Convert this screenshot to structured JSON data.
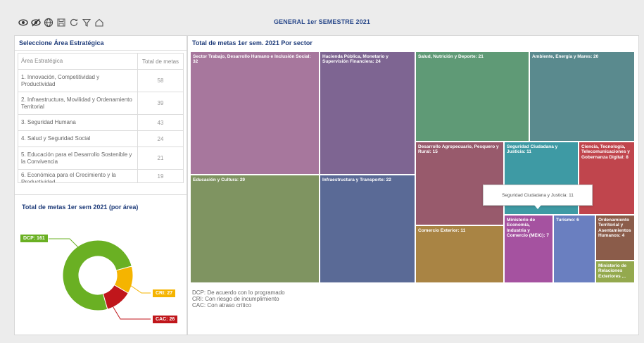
{
  "page_title": "GENERAL 1er SEMESTRE 2021",
  "toolbar": {
    "icons": [
      "visibility-icon",
      "visibility-off-icon",
      "globe-icon",
      "save-icon",
      "refresh-icon",
      "filter-icon",
      "home-icon"
    ]
  },
  "area_table": {
    "title": "Seleccione Área Estratégica",
    "col_area": "Área Estratégica",
    "col_total": "Total de metas",
    "rows": [
      {
        "area": "1. Innovación, Competitividad y Productividad",
        "total": "58"
      },
      {
        "area": "2. Infraestructura, Movilidad y Ordenamiento Territorial",
        "total": "39"
      },
      {
        "area": "3. Seguridad Humana",
        "total": "43"
      },
      {
        "area": "4. Salud y Seguridad Social",
        "total": "24"
      },
      {
        "area": "5. Educación para el Desarrollo Sostenible y la Convivencia",
        "total": "21"
      },
      {
        "area": "6. Económica para el Crecimiento y la Productividad",
        "total": "19"
      }
    ]
  },
  "donut": {
    "title": "Total de metas 1er sem 2021 (por área)",
    "labels": {
      "dcp": "DCP: 161",
      "cri": "CRI: 27",
      "cac": "CAC: 26"
    },
    "colors": {
      "dcp": "#6ab023",
      "cri": "#f5b400",
      "cac": "#c0161b"
    },
    "chart_data": {
      "type": "pie",
      "categories": [
        "DCP",
        "CRI",
        "CAC"
      ],
      "values": [
        161,
        27,
        26
      ]
    }
  },
  "treemap": {
    "title": "Total de metas 1er sem. 2021 Por sector",
    "cells": [
      {
        "label": "Sector Trabajo, Desarrollo Humano e Inclusión Social: 32",
        "value": 32,
        "color": "#a7779d"
      },
      {
        "label": "Hacienda Pública, Monetario y Supervisión Financiera: 24",
        "value": 24,
        "color": "#7e6592"
      },
      {
        "label": "Salud, Nutrición y Deporte: 21",
        "value": 21,
        "color": "#5f9a76"
      },
      {
        "label": "Ambiente, Energía y Mares: 20",
        "value": 20,
        "color": "#5a8a8e"
      },
      {
        "label": "Educación y Cultura: 29",
        "value": 29,
        "color": "#7f9461"
      },
      {
        "label": "Infraestructura y Transporte: 22",
        "value": 22,
        "color": "#5a6a96"
      },
      {
        "label": "Desarrollo Agropecuario, Pesquero y Rural: 15",
        "value": 15,
        "color": "#985a6c"
      },
      {
        "label": "Seguridad Ciudadana y Justicia: 11",
        "value": 11,
        "color": "#3e9aa4"
      },
      {
        "label": "Ciencia, Tecnología, Telecomunicaciones y Gobernanza Digital: 8",
        "value": 8,
        "color": "#c0454d"
      },
      {
        "label": "Comercio Exterior: 11",
        "value": 11,
        "color": "#a98444"
      },
      {
        "label": "Ministerio de Economía, Industria y Comercio (MEIC): 7",
        "value": 7,
        "color": "#a552a0"
      },
      {
        "label": "Turismo: 6",
        "value": 6,
        "color": "#6a7fc0"
      },
      {
        "label": "Ordenamiento Territorial y Asentamientos Humanos: 4",
        "value": 4,
        "color": "#8b5c4a"
      },
      {
        "label": "Ministerio de Relaciones Exteriores ...",
        "value": 3,
        "color": "#94a94e"
      }
    ],
    "tooltip": "Seguridad Ciudadana y Justicia: 11",
    "legend_notes": [
      "DCP: De acuerdo con lo programado",
      "CRI: Con riesgo de incumplimiento",
      "CAC: Con atraso crítico"
    ]
  }
}
